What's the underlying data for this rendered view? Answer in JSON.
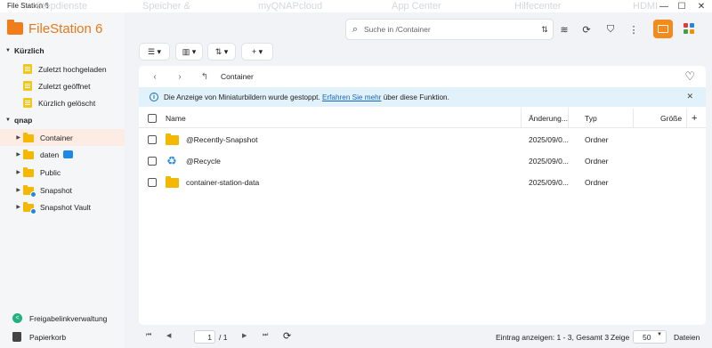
{
  "window": {
    "title": "File Station 6",
    "ghost_tabs": [
      "Stepdienste",
      "Speicher &",
      "myQNAPcloud",
      "App Center",
      "Hilfecenter",
      "HDMI"
    ]
  },
  "sidebar": {
    "app_name": "FileStation 6",
    "sections": [
      {
        "label": "Kürzlich",
        "items": [
          {
            "label": "Zuletzt hochgeladen",
            "icon": "recent-doc-icon"
          },
          {
            "label": "Zuletzt geöffnet",
            "icon": "recent-doc-icon"
          },
          {
            "label": "Kürzlich gelöscht",
            "icon": "recent-doc-icon"
          }
        ]
      },
      {
        "label": "qnap",
        "items": [
          {
            "label": "Container",
            "icon": "folder-icon",
            "active": true
          },
          {
            "label": "daten",
            "icon": "folder-icon"
          },
          {
            "label": "Public",
            "icon": "folder-icon"
          },
          {
            "label": "Snapshot",
            "icon": "folder-icon"
          },
          {
            "label": "Snapshot Vault",
            "icon": "folder-icon"
          }
        ]
      }
    ],
    "bottom": {
      "share_links": "Freigabelinkverwaltung",
      "trash": "Papierkorb"
    }
  },
  "search": {
    "placeholder": "Suche in /Container"
  },
  "breadcrumb": {
    "current": "Container"
  },
  "infobar": {
    "text_before": "Die Anzeige von Miniaturbildern wurde gestoppt.",
    "link": "Erfahren Sie mehr",
    "text_after": "über diese Funktion."
  },
  "table": {
    "columns": {
      "name": "Name",
      "modified": "Änderung...",
      "type": "Typ",
      "size": "Größe"
    },
    "rows": [
      {
        "name": "@Recently-Snapshot",
        "modified": "2025/09/0...",
        "type": "Ordner",
        "icon": "folder-icon"
      },
      {
        "name": "@Recycle",
        "modified": "2025/09/0...",
        "type": "Ordner",
        "icon": "recycle-icon"
      },
      {
        "name": "container-station-data",
        "modified": "2025/09/0...",
        "type": "Ordner",
        "icon": "folder-icon"
      }
    ]
  },
  "footer": {
    "page": "1",
    "total_pages": "/ 1",
    "entries_text": "Eintrag anzeigen: 1 - 3, Gesamt 3",
    "show_label": "Zeige",
    "per_page": "50",
    "files_label": "Dateien"
  },
  "colors": {
    "accent": "#f28a1c",
    "folder": "#f5b800",
    "info_bg": "#e1f2fb",
    "link": "#1565c0"
  }
}
